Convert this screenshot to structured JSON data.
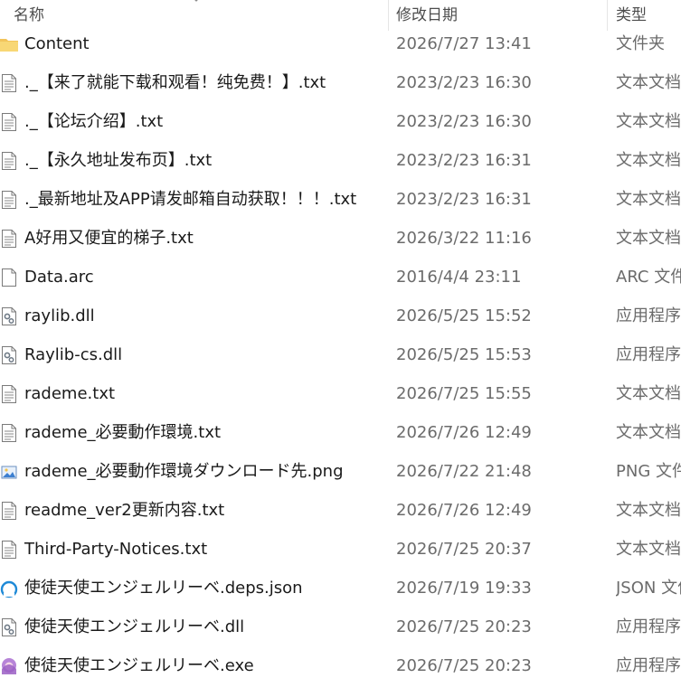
{
  "columns": {
    "name": "名称",
    "date": "修改日期",
    "type": "类型"
  },
  "files": [
    {
      "name": "Content",
      "date": "2026/7/27 13:41",
      "type": "文件夹",
      "icon": "folder"
    },
    {
      "name": "._【来了就能下载和观看！纯免费！】.txt",
      "date": "2023/2/23 16:30",
      "type": "文本文档",
      "icon": "text"
    },
    {
      "name": "._【论坛介绍】.txt",
      "date": "2023/2/23 16:30",
      "type": "文本文档",
      "icon": "text"
    },
    {
      "name": "._【永久地址发布页】.txt",
      "date": "2023/2/23 16:31",
      "type": "文本文档",
      "icon": "text"
    },
    {
      "name": "._最新地址及APP请发邮箱自动获取！！！.txt",
      "date": "2023/2/23 16:31",
      "type": "文本文档",
      "icon": "text"
    },
    {
      "name": "A好用又便宜的梯子.txt",
      "date": "2026/3/22 11:16",
      "type": "文本文档",
      "icon": "text"
    },
    {
      "name": "Data.arc",
      "date": "2016/4/4 23:11",
      "type": "ARC 文件",
      "icon": "blank"
    },
    {
      "name": "raylib.dll",
      "date": "2026/5/25 15:52",
      "type": "应用程序扩展",
      "icon": "dll"
    },
    {
      "name": "Raylib-cs.dll",
      "date": "2026/5/25 15:53",
      "type": "应用程序扩展",
      "icon": "dll"
    },
    {
      "name": "rademe.txt",
      "date": "2026/7/25 15:55",
      "type": "文本文档",
      "icon": "text"
    },
    {
      "name": "rademe_必要動作環境.txt",
      "date": "2026/7/26 12:49",
      "type": "文本文档",
      "icon": "text"
    },
    {
      "name": "rademe_必要動作環境ダウンロード先.png",
      "date": "2026/7/22 21:48",
      "type": "PNG 文件",
      "icon": "image"
    },
    {
      "name": "readme_ver2更新内容.txt",
      "date": "2026/7/26 12:49",
      "type": "文本文档",
      "icon": "text"
    },
    {
      "name": "Third-Party-Notices.txt",
      "date": "2026/7/25 20:37",
      "type": "文本文档",
      "icon": "text"
    },
    {
      "name": "使徒天使エンジェルリーベ.deps.json",
      "date": "2026/7/19 19:33",
      "type": "JSON 文件",
      "icon": "json"
    },
    {
      "name": "使徒天使エンジェルリーベ.dll",
      "date": "2026/7/25 20:23",
      "type": "应用程序扩展",
      "icon": "dll"
    },
    {
      "name": "使徒天使エンジェルリーベ.exe",
      "date": "2026/7/25 20:23",
      "type": "应用程序",
      "icon": "exe"
    }
  ]
}
